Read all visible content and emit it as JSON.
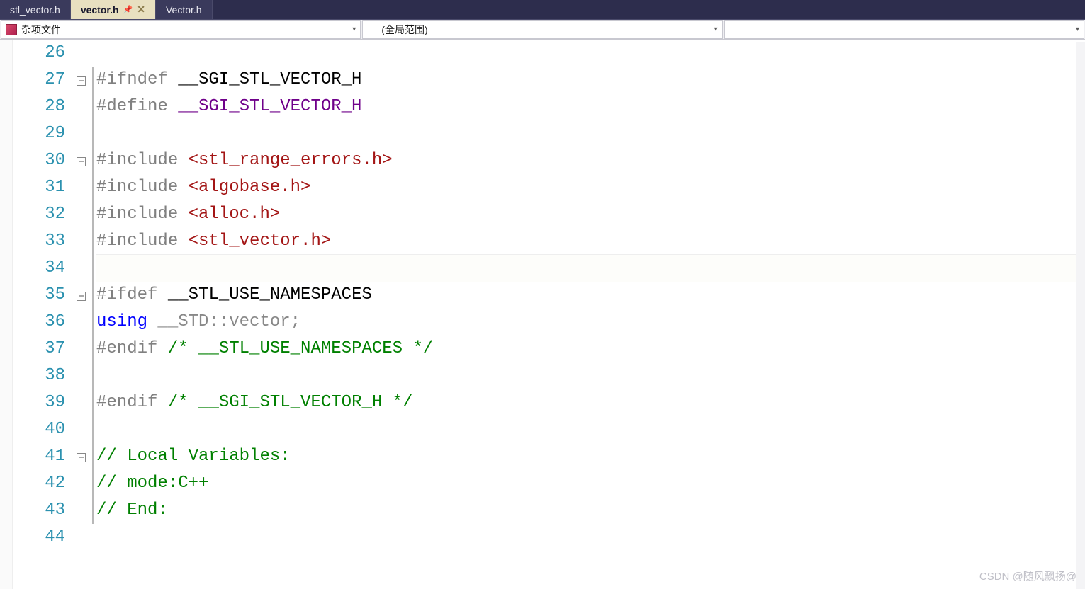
{
  "tabs": [
    {
      "label": "stl_vector.h",
      "active": false
    },
    {
      "label": "vector.h",
      "active": true,
      "pinned": true,
      "closable": true
    },
    {
      "label": "Vector.h",
      "active": false
    }
  ],
  "dropdowns": {
    "project": "杂项文件",
    "scope": "(全局范围)",
    "member": ""
  },
  "code": {
    "first_line": 26,
    "current_line": 34,
    "lines": [
      {
        "n": 26,
        "fold": "",
        "segs": []
      },
      {
        "n": 27,
        "fold": "minus",
        "segs": [
          {
            "t": "#ifndef ",
            "c": "pp"
          },
          {
            "t": "__SGI_STL_VECTOR_H",
            "c": ""
          }
        ]
      },
      {
        "n": 28,
        "fold": "bar",
        "segs": [
          {
            "t": "#define ",
            "c": "pp"
          },
          {
            "t": "__SGI_STL_VECTOR_H",
            "c": "mac"
          }
        ]
      },
      {
        "n": 29,
        "fold": "bar",
        "segs": []
      },
      {
        "n": 30,
        "fold": "minus",
        "segs": [
          {
            "t": "#include ",
            "c": "pp"
          },
          {
            "t": "<stl_range_errors.h>",
            "c": "inc"
          }
        ]
      },
      {
        "n": 31,
        "fold": "bar",
        "segs": [
          {
            "t": "#include ",
            "c": "pp"
          },
          {
            "t": "<algobase.h>",
            "c": "inc"
          }
        ]
      },
      {
        "n": 32,
        "fold": "bar",
        "segs": [
          {
            "t": "#include ",
            "c": "pp"
          },
          {
            "t": "<alloc.h>",
            "c": "inc"
          }
        ]
      },
      {
        "n": 33,
        "fold": "bar",
        "segs": [
          {
            "t": "#include ",
            "c": "pp"
          },
          {
            "t": "<stl_vector.h>",
            "c": "inc"
          }
        ]
      },
      {
        "n": 34,
        "fold": "bar",
        "segs": []
      },
      {
        "n": 35,
        "fold": "minus",
        "segs": [
          {
            "t": "#ifdef ",
            "c": "pp"
          },
          {
            "t": "__STL_USE_NAMESPACES",
            "c": ""
          }
        ]
      },
      {
        "n": 36,
        "fold": "bar",
        "segs": [
          {
            "t": "using ",
            "c": "kw"
          },
          {
            "t": "__STD::vector;",
            "c": "dim"
          }
        ]
      },
      {
        "n": 37,
        "fold": "bar",
        "segs": [
          {
            "t": "#endif ",
            "c": "pp"
          },
          {
            "t": "/* __STL_USE_NAMESPACES */",
            "c": "cm"
          }
        ]
      },
      {
        "n": 38,
        "fold": "bar",
        "segs": []
      },
      {
        "n": 39,
        "fold": "bar",
        "segs": [
          {
            "t": "#endif ",
            "c": "pp"
          },
          {
            "t": "/* __SGI_STL_VECTOR_H */",
            "c": "cm"
          }
        ]
      },
      {
        "n": 40,
        "fold": "bar",
        "segs": []
      },
      {
        "n": 41,
        "fold": "minus",
        "segs": [
          {
            "t": "// Local Variables:",
            "c": "cm"
          }
        ]
      },
      {
        "n": 42,
        "fold": "bar",
        "segs": [
          {
            "t": "// mode:C++",
            "c": "cm"
          }
        ]
      },
      {
        "n": 43,
        "fold": "bar",
        "segs": [
          {
            "t": "// End:",
            "c": "cm"
          }
        ]
      },
      {
        "n": 44,
        "fold": "",
        "segs": []
      }
    ]
  },
  "watermark": "CSDN @随风飘扬@"
}
